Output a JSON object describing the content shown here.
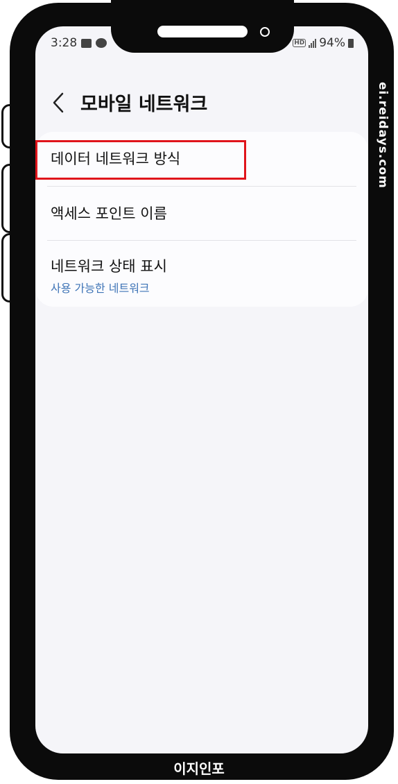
{
  "status_bar": {
    "time": "3:28",
    "left_icons": [
      "gallery-icon",
      "kakaotalk-icon",
      "notification-icon"
    ],
    "hd_label": "HD",
    "battery": "94%"
  },
  "header": {
    "back_icon": "chevron-left-icon",
    "title": "모바일 네트워크"
  },
  "settings": {
    "items": [
      {
        "label": "데이터 네트워크 방식"
      },
      {
        "label": "액세스 포인트 이름"
      },
      {
        "label": "네트워크 상태 표시",
        "sub": "사용 가능한 네트워크"
      }
    ]
  },
  "highlight_color": "#e0141b",
  "watermark": "ei.reidays.com",
  "bottom_label": "이지인포"
}
